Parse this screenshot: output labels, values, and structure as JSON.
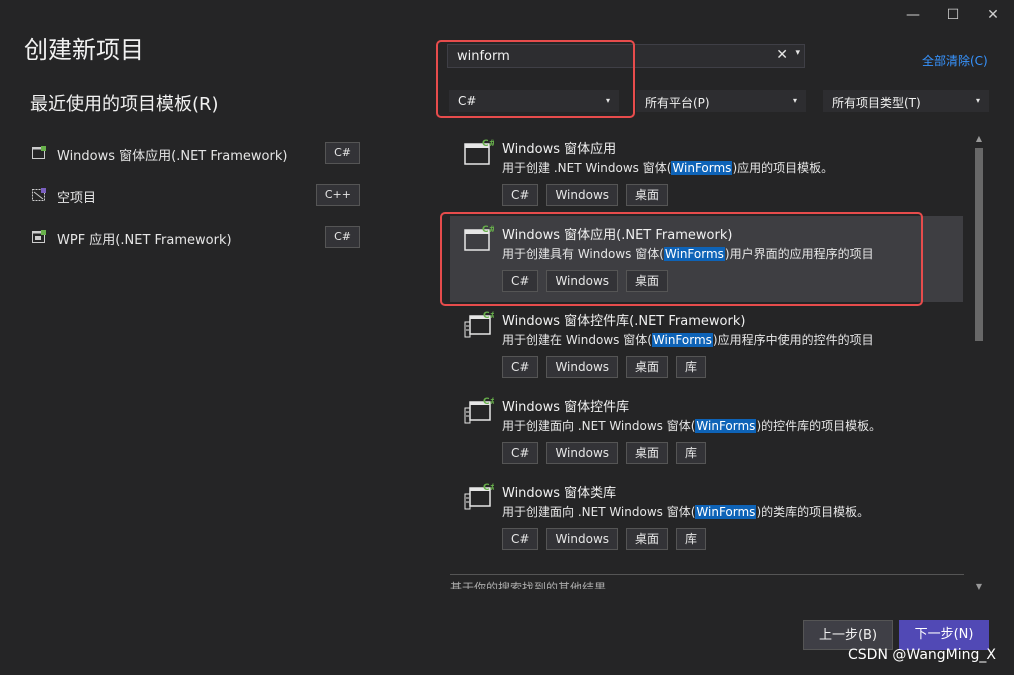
{
  "window": {
    "minimize_icon": "—",
    "maximize_icon": "☐",
    "close_icon": "✕"
  },
  "page": {
    "title": "创建新项目",
    "recent_heading": "最近使用的项目模板(R)"
  },
  "recent_templates": [
    {
      "label": "Windows 窗体应用(.NET Framework)",
      "lang": "C#",
      "icon": "winform-template-icon"
    },
    {
      "label": "空项目",
      "lang": "C++",
      "icon": "empty-project-icon"
    },
    {
      "label": "WPF 应用(.NET Framework)",
      "lang": "C#",
      "icon": "wpf-template-icon"
    }
  ],
  "search": {
    "value": "winform",
    "clear_icon": "✕",
    "dropdown_icon": "▾"
  },
  "clear_all_label": "全部清除(C)",
  "filters": {
    "language": "C#",
    "platform": "所有平台(P)",
    "project_type": "所有项目类型(T)",
    "caret": "▾"
  },
  "results": [
    {
      "name": "Windows 窗体应用",
      "desc_pre": "用于创建 .NET Windows 窗体(",
      "desc_hl": "WinForms",
      "desc_post": ")应用的项目模板。",
      "tags": [
        "C#",
        "Windows",
        "桌面"
      ]
    },
    {
      "name": "Windows 窗体应用(.NET Framework)",
      "desc_pre": "用于创建具有 Windows 窗体(",
      "desc_hl": "WinForms",
      "desc_post": ")用户界面的应用程序的项目",
      "tags": [
        "C#",
        "Windows",
        "桌面"
      ]
    },
    {
      "name": "Windows 窗体控件库(.NET Framework)",
      "desc_pre": "用于创建在 Windows 窗体(",
      "desc_hl": "WinForms",
      "desc_post": ")应用程序中使用的控件的项目",
      "tags": [
        "C#",
        "Windows",
        "桌面",
        "库"
      ]
    },
    {
      "name": "Windows 窗体控件库",
      "desc_pre": "用于创建面向 .NET Windows 窗体(",
      "desc_hl": "WinForms",
      "desc_post": ")的控件库的项目模板。",
      "tags": [
        "C#",
        "Windows",
        "桌面",
        "库"
      ]
    },
    {
      "name": "Windows 窗体类库",
      "desc_pre": "用于创建面向 .NET Windows 窗体(",
      "desc_hl": "WinForms",
      "desc_post": ")的类库的项目模板。",
      "tags": [
        "C#",
        "Windows",
        "桌面",
        "库"
      ]
    }
  ],
  "other_results_label": "基于你的搜索找到的其他结果",
  "scrollbar": {
    "up": "▲",
    "down": "▼"
  },
  "buttons": {
    "back": "上一步(B)",
    "next": "下一步(N)"
  },
  "watermark": "CSDN @WangMing_X",
  "colors": {
    "accent": "#5149b5",
    "highlight": "#0e63b7",
    "annotation": "#e74c4c",
    "link": "#3794ff"
  }
}
